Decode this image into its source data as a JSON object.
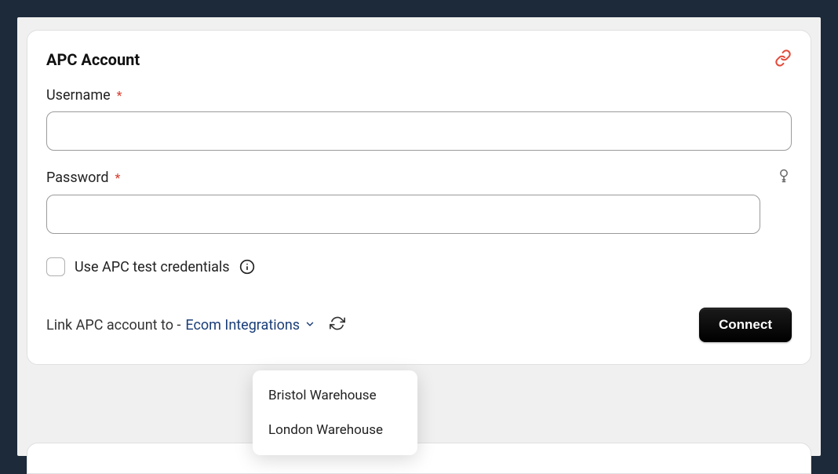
{
  "card": {
    "title": "APC Account",
    "username": {
      "label": "Username",
      "required": "*",
      "value": ""
    },
    "password": {
      "label": "Password",
      "required": "*",
      "value": ""
    },
    "testCredentials": {
      "label": "Use APC test credentials",
      "checked": false
    },
    "linkAccount": {
      "prefix": "Link APC account to -",
      "selected": "Ecom Integrations"
    },
    "connectButton": "Connect",
    "dropdown": {
      "options": [
        "Bristol Warehouse",
        "London Warehouse"
      ]
    }
  }
}
